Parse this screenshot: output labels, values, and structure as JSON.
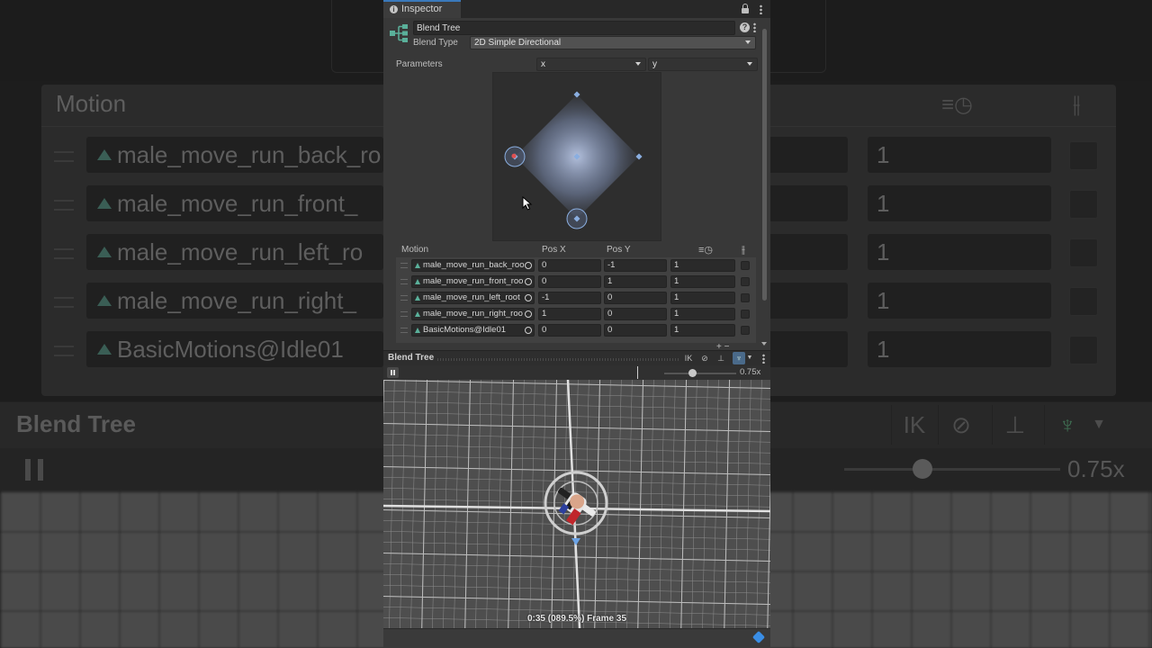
{
  "background": {
    "motion_title": "Motion",
    "rows": [
      "male_move_run_back_ro",
      "male_move_run_front_",
      "male_move_run_left_ro",
      "male_move_run_right_",
      "BasicMotions@Idle01"
    ],
    "thresholds": [
      "1",
      "1",
      "1",
      "1",
      "1"
    ],
    "blend_tree_title": "Blend Tree",
    "speed": "0.75x",
    "ik_label": "IK"
  },
  "inspector": {
    "tab_label": "Inspector",
    "name_value": "Blend Tree",
    "blend_type_label": "Blend Type",
    "blend_type_value": "2D Simple Directional",
    "parameters_label": "Parameters",
    "param_x": "x",
    "param_y": "y"
  },
  "blend_graph": {
    "motion_points": [
      {
        "x": 0,
        "y": -1
      },
      {
        "x": 0,
        "y": 1
      },
      {
        "x": -1,
        "y": 0
      },
      {
        "x": 1,
        "y": 0
      },
      {
        "x": 0,
        "y": 0
      }
    ],
    "highlighted_points": [
      {
        "x": -1,
        "y": 0
      },
      {
        "x": 0,
        "y": -1
      }
    ],
    "current_parameter": {
      "x": -1,
      "y": -0.7
    },
    "accent_color": "#8aaee0",
    "current_color": "#e05050"
  },
  "motion_table": {
    "headers": {
      "motion": "Motion",
      "pos_x": "Pos X",
      "pos_y": "Pos Y"
    },
    "rows": [
      {
        "clip": "male_move_run_back_roo",
        "pos_x": "0",
        "pos_y": "-1",
        "time": "1"
      },
      {
        "clip": "male_move_run_front_roo",
        "pos_x": "0",
        "pos_y": "1",
        "time": "1"
      },
      {
        "clip": "male_move_run_left_root",
        "pos_x": "-1",
        "pos_y": "0",
        "time": "1"
      },
      {
        "clip": "male_move_run_right_roo",
        "pos_x": "1",
        "pos_y": "0",
        "time": "1"
      },
      {
        "clip": "BasicMotions@Idle01",
        "pos_x": "0",
        "pos_y": "0",
        "time": "1"
      }
    ]
  },
  "preview": {
    "title": "Blend Tree",
    "ik_label": "IK",
    "speed": "0.75x",
    "status": "0:35 (089.5%) Frame 35"
  }
}
